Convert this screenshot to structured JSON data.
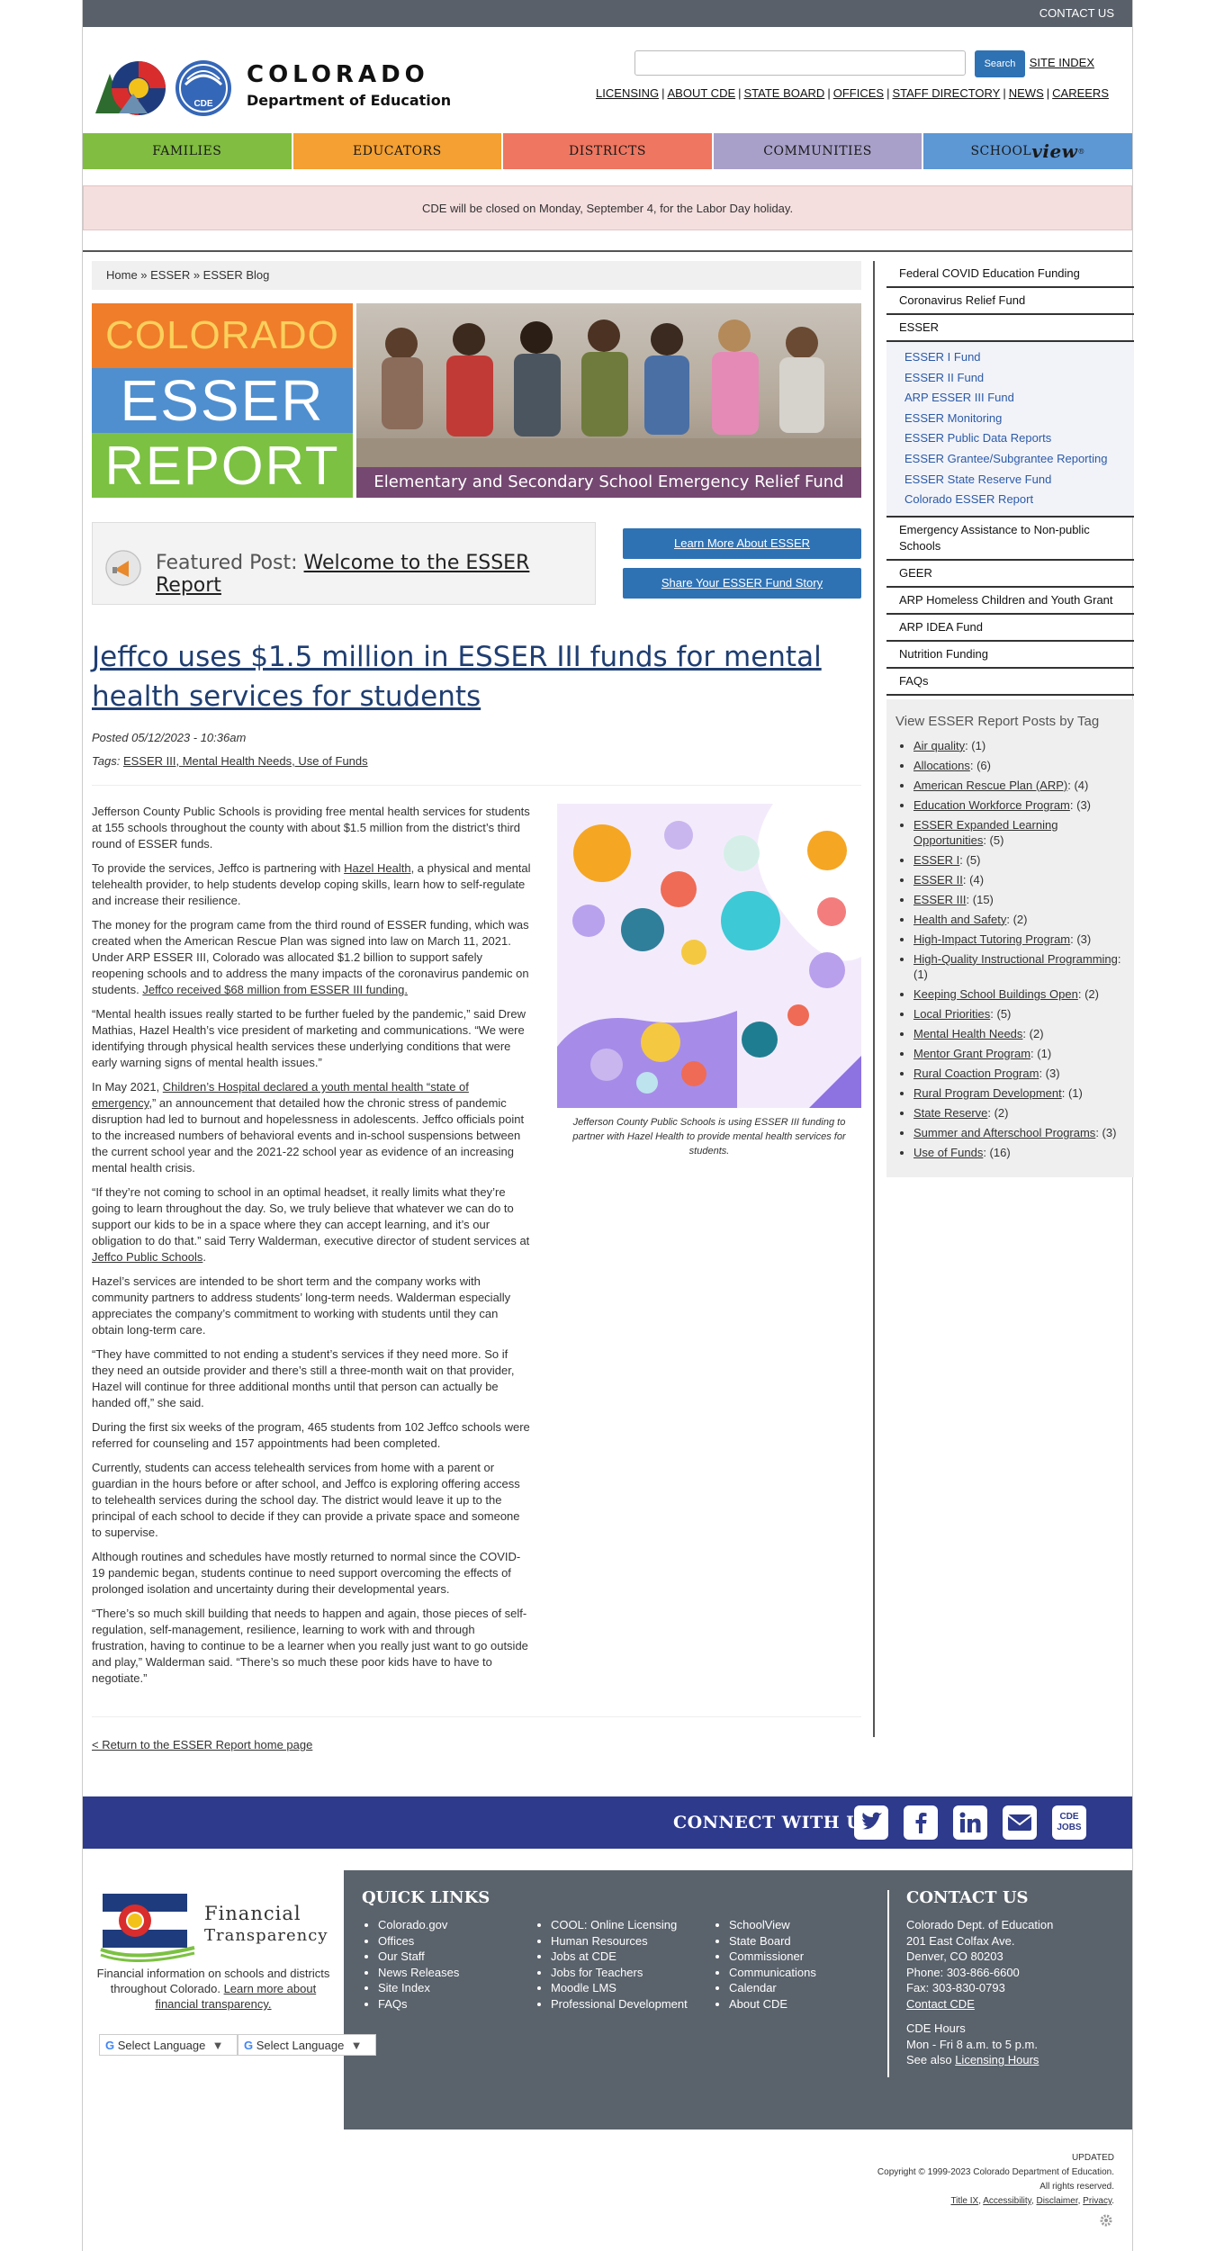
{
  "topbar": {
    "contact": "CONTACT US"
  },
  "header": {
    "logo_line1": "COLORADO",
    "logo_line2": "Department of Education",
    "logo_badge": "CDE",
    "search_button": "Search",
    "search_placeholder": "",
    "site_index": "SITE INDEX",
    "utility_links": [
      "LICENSING",
      "ABOUT CDE",
      "STATE BOARD",
      "OFFICES",
      "STAFF DIRECTORY",
      "NEWS",
      "CAREERS"
    ]
  },
  "nav": {
    "items": [
      {
        "label": "FAMILIES",
        "color": "#80bd41"
      },
      {
        "label": "EDUCATORS",
        "color": "#f4a032"
      },
      {
        "label": "DISTRICTS",
        "color": "#ef7660"
      },
      {
        "label": "COMMUNITIES",
        "color": "#a8a0c9"
      }
    ],
    "schoolview_a": "SCHOOL",
    "schoolview_b": "view",
    "schoolview_color": "#5d97d4"
  },
  "alert": "CDE will be closed on Monday, September 4, for the Labor Day holiday.",
  "breadcrumb": "Home » ESSER » ESSER Blog",
  "banner": {
    "colorado": "COLORADO",
    "esser": "ESSER",
    "report": "REPORT",
    "caption": "Elementary and Secondary School Emergency Relief Fund"
  },
  "featured": {
    "prefix": "Featured Post:",
    "link": "Welcome to the ESSER Report",
    "button1": "Learn More About ESSER",
    "button2": "Share Your ESSER Fund Story"
  },
  "post": {
    "title": "Jeffco uses $1.5 million in ESSER III funds for mental health services for students",
    "posted": "Posted 05/12/2023 - 10:36am",
    "tags_label": "Tags:",
    "tags": "ESSER III, Mental Health Needs, Use of Funds",
    "p1": "Jefferson County Public Schools is providing free mental health services for students at 155 schools throughout the county with about $1.5 million from the district’s third round of ESSER funds.",
    "p2a": "To provide the services, Jeffco is partnering with ",
    "p2link": "Hazel Health",
    "p2b": ", a physical and mental telehealth provider, to help students develop coping skills, learn how to self-regulate and increase their resilience.",
    "p3a": "The money for the program came from the third round of ESSER funding, which was created when the American Rescue Plan was signed into law on March 11, 2021. Under ARP ESSER III, Colorado was allocated $1.2 billion to support safely reopening schools and to address the many impacts of the coronavirus pandemic on students. ",
    "p3link": "Jeffco received $68 million from ESSER III funding.",
    "p4": "“Mental health issues really started to be further fueled by the pandemic,” said Drew Mathias, Hazel Health’s vice president of marketing and communications. “We were identifying through physical health services these underlying conditions that were early warning signs of mental health issues.”",
    "p5a": "In May 2021, ",
    "p5link": "Children’s Hospital declared a youth mental health “state of emergency",
    "p5b": ",” an announcement that detailed how the chronic stress of pandemic disruption had led to burnout and hopelessness in adolescents. Jeffco officials point to the increased numbers of behavioral events and in-school suspensions between the current school year and the 2021-22 school year as evidence of an increasing mental health crisis.",
    "p6a": "“If they’re not coming to school in an optimal headset, it really limits what they’re going to learn throughout the day. So, we truly believe that whatever we can do to support our kids to be in a space where they can accept learning, and it’s our obligation to do that.” said Terry Walderman, executive director of student services at ",
    "p6link": "Jeffco Public Schools",
    "p6b": ".",
    "p7": "Hazel’s services are intended to be short term and the company works with community partners to address students’ long-term needs. Walderman especially appreciates the company’s commitment to working with students until they can obtain long-term care.",
    "p8": "“They have committed to not ending a student’s services if they need more. So if they need an outside provider and there’s still a three-month wait on that provider, Hazel will continue for three additional months until that person can actually be handed off,” she said.",
    "p9": "During the first six weeks of the program, 465 students from 102 Jeffco schools were referred for counseling and 157 appointments had been completed.",
    "p10": "Currently, students can access telehealth services from home with a parent or guardian in the hours before or after school, and Jeffco is exploring offering access to telehealth services during the school day. The district would leave it up to the principal of each school to decide if they can provide a private space and someone to supervise.",
    "p11": "Although routines and schedules have mostly returned to normal since the COVID-19 pandemic began, students continue to need support overcoming the effects of prolonged isolation and uncertainty during their developmental years.",
    "p12": "“There’s so much skill building that needs to happen and again, those pieces of self-regulation, self-management, resilience, learning to work with and through frustration, having to continue to be a learner when you really just want to go outside and play,” Walderman said. “There’s so much these poor kids have to have to negotiate.”",
    "figure_caption": "Jefferson County Public Schools is using ESSER III funding to partner with Hazel Health to provide mental health services for students.",
    "return_link": "< Return to the ESSER Report home page"
  },
  "sidebar": {
    "top_items": [
      "Federal COVID Education Funding",
      "Coronavirus Relief Fund",
      "ESSER"
    ],
    "esser_sub": [
      "ESSER I Fund",
      "ESSER II Fund",
      "ARP ESSER III Fund",
      "ESSER Monitoring",
      "ESSER Public Data Reports",
      "ESSER Grantee/Subgrantee Reporting",
      "ESSER State Reserve Fund",
      "Colorado ESSER Report"
    ],
    "bottom_items": [
      "Emergency Assistance to Non-public Schools",
      "GEER",
      "ARP Homeless Children and Youth Grant",
      "ARP IDEA Fund",
      "Nutrition Funding",
      "FAQs"
    ],
    "tags_heading": "View ESSER Report Posts by Tag",
    "tags": [
      {
        "name": "Air quality",
        "count": ": (1)"
      },
      {
        "name": "Allocations",
        "count": ": (6)"
      },
      {
        "name": "American Rescue Plan (ARP)",
        "count": ": (4)"
      },
      {
        "name": "Education Workforce Program",
        "count": ": (3)"
      },
      {
        "name": "ESSER Expanded Learning Opportunities",
        "count": ": (5)"
      },
      {
        "name": "ESSER I",
        "count": ": (5)"
      },
      {
        "name": "ESSER II",
        "count": ": (4)"
      },
      {
        "name": "ESSER III",
        "count": ": (15)"
      },
      {
        "name": "Health and Safety",
        "count": ": (2)"
      },
      {
        "name": "High-Impact Tutoring Program",
        "count": ": (3)"
      },
      {
        "name": "High-Quality Instructional Programming",
        "count": ": (1)"
      },
      {
        "name": "Keeping School Buildings Open",
        "count": ": (2)"
      },
      {
        "name": "Local Priorities",
        "count": ": (5)"
      },
      {
        "name": "Mental Health Needs",
        "count": ": (2)"
      },
      {
        "name": "Mentor Grant Program",
        "count": ": (1)"
      },
      {
        "name": "Rural Coaction Program",
        "count": ": (3)"
      },
      {
        "name": "Rural Program Development",
        "count": ": (1)"
      },
      {
        "name": "State Reserve",
        "count": ": (2)"
      },
      {
        "name": "Summer and Afterschool Programs",
        "count": ": (3)"
      },
      {
        "name": "Use of Funds",
        "count": ": (16)"
      }
    ]
  },
  "connect": {
    "title": "CONNECT WITH US",
    "icons": [
      "twitter-icon",
      "facebook-icon",
      "linkedin-icon",
      "email-icon",
      "cde-jobs-icon"
    ],
    "jobs_line1": "CDE",
    "jobs_line2": "JOBS"
  },
  "footer": {
    "ft_title1": "Financial",
    "ft_title2": "Transparency",
    "ft_desc": "Financial information on schools and districts throughout Colorado. ",
    "ft_link": "Learn more about financial transparency.",
    "lang1": "Select Language",
    "lang2": "Select Language",
    "quick_links_title": "QUICK LINKS",
    "col1": [
      "Colorado.gov",
      "Offices",
      "Our Staff",
      "News Releases",
      "Site Index",
      "FAQs"
    ],
    "col2": [
      "COOL: Online Licensing",
      "Human Resources",
      "Jobs at CDE",
      "Jobs for Teachers",
      "Moodle LMS",
      "Professional Development"
    ],
    "col3": [
      "SchoolView",
      "State Board",
      "Commissioner",
      "Communications",
      "Calendar",
      "About CDE"
    ],
    "contact_title": "CONTACT US",
    "contact_lines": [
      "Colorado Dept. of Education",
      "201 East Colfax Ave.",
      "Denver, CO 80203",
      "Phone: 303-866-6600",
      "Fax: 303-830-0793"
    ],
    "contact_link": "Contact CDE",
    "hours_title": "CDE Hours",
    "hours": "Mon - Fri 8 a.m. to 5 p.m.",
    "see_also": "See also ",
    "licensing_hours": "Licensing Hours"
  },
  "legal": {
    "updated": "UPDATED",
    "copyright": "Copyright © 1999-2023 Colorado Department of Education.",
    "rights": "All rights reserved.",
    "links": [
      "Title IX",
      "Accessibility",
      "Disclaimer",
      "Privacy"
    ]
  }
}
